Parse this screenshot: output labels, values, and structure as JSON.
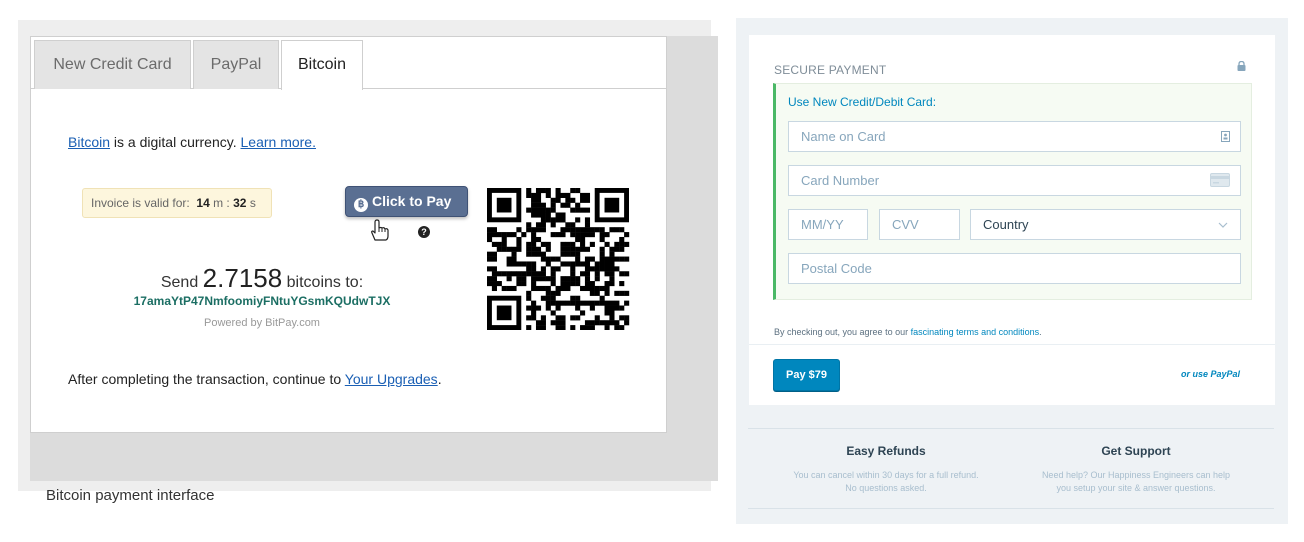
{
  "bitcoin_panel": {
    "tabs": [
      {
        "label": "New Credit Card",
        "active": false
      },
      {
        "label": "PayPal",
        "active": false
      },
      {
        "label": "Bitcoin",
        "active": true
      }
    ],
    "intro_link": "Bitcoin",
    "intro_text": " is a digital currency. ",
    "learn_more": "Learn more.",
    "invoice_label": "Invoice is valid for:",
    "invoice_minutes": "14",
    "invoice_m": "m",
    "invoice_seconds": "32",
    "invoice_s": "s",
    "pay_button": "Click to Pay",
    "pay_button_icon": "bitcoin-icon",
    "send_prefix": "Send",
    "amount": "2.7158",
    "send_suffix": "bitcoins to:",
    "address": "17amaYtP47NmfoomiyFNtuYGsmKQUdwTJX",
    "powered_by": "Powered by BitPay.com",
    "after_text": "After completing the transaction, continue to ",
    "upgrades_link": "Your Upgrades",
    "after_end": ".",
    "caption": "Bitcoin payment interface"
  },
  "secure_payment": {
    "title": "SECURE PAYMENT",
    "heading": "Use New Credit/Debit Card:",
    "fields": {
      "name": "Name on Card",
      "number": "Card Number",
      "expiry": "MM/YY",
      "cvv": "CVV",
      "country": "Country",
      "postal": "Postal Code"
    },
    "terms_prefix": "By checking out, you agree to our ",
    "terms_link": "fascinating terms and conditions",
    "terms_suffix": ".",
    "pay_button": "Pay $79",
    "paypal_link": "or use PayPal",
    "features": [
      {
        "title": "Easy Refunds",
        "line1": "You can cancel within 30 days for a full refund.",
        "line2": "No questions asked."
      },
      {
        "title": "Get Support",
        "line1": "Need help? Our Happiness Engineers can help",
        "line2": "you setup your site & answer questions."
      }
    ]
  },
  "colors": {
    "primary_blue": "#0087be",
    "green_accent": "#4ab866",
    "bitpay_button": "#5a6f92",
    "address_green": "#1b6e63"
  }
}
